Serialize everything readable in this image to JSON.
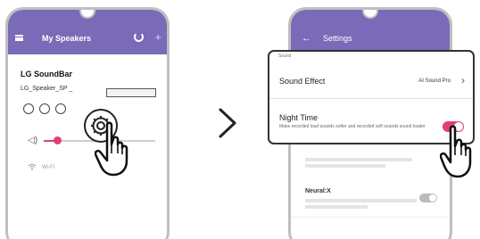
{
  "left_phone": {
    "app_title": "My Speakers",
    "device": {
      "name": "LG SoundBar",
      "id": "LG_Speaker_SP _"
    },
    "wifi_label": "Wi-Fi"
  },
  "arrow": "next-step-chevron",
  "right_phone": {
    "app_title": "Settings",
    "section_label": "Sound",
    "settings": [
      {
        "label": "Sound Effect",
        "value": "AI Sound Pro"
      },
      {
        "label": "Night Time",
        "description": "Make recorded loud sounds softer and recorded soft sounds sound louder",
        "toggle": "on"
      }
    ],
    "background_rows": [
      {
        "label": "",
        "description": "...",
        "toggle": "off"
      },
      {
        "label": "Neural:X",
        "description": "...",
        "toggle": "off"
      }
    ]
  },
  "colors": {
    "app_bar": "#7b6ab8",
    "accent": "#e04070",
    "phone_frame": "#bfbfbf"
  },
  "icons": [
    "menu-icon",
    "refresh-icon",
    "add-icon",
    "back-arrow-icon",
    "volume-icon",
    "wifi-icon",
    "gear-icon",
    "chevron-right-icon",
    "hand-pointer-icon"
  ]
}
